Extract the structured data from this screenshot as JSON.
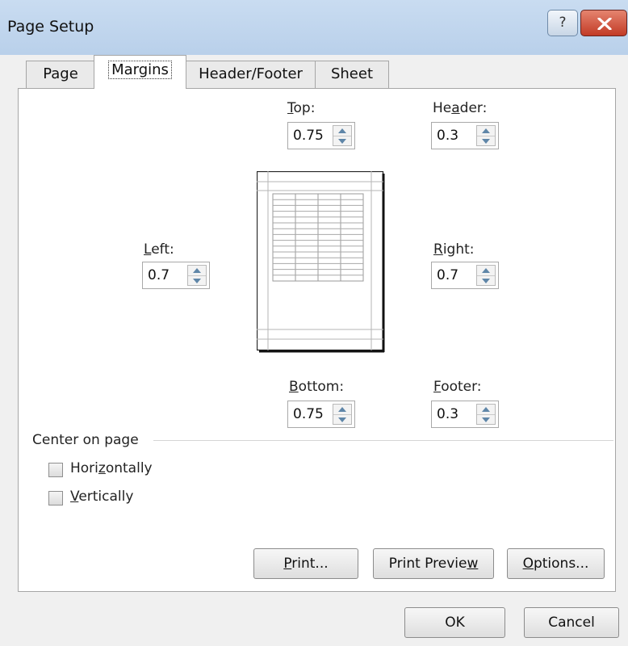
{
  "window": {
    "title": "Page Setup",
    "help_label": "?"
  },
  "tabs": [
    {
      "label": "Page",
      "active": false
    },
    {
      "label": "Margins",
      "active": true
    },
    {
      "label": "Header/Footer",
      "active": false
    },
    {
      "label": "Sheet",
      "active": false
    }
  ],
  "margins": {
    "top": {
      "label_key": "T",
      "label_rest": "op:",
      "value": "0.75"
    },
    "header": {
      "label_pre": "He",
      "label_key": "a",
      "label_post": "der:",
      "value": "0.3"
    },
    "left": {
      "label_key": "L",
      "label_rest": "eft:",
      "value": "0.7"
    },
    "right": {
      "label_key": "R",
      "label_rest": "ight:",
      "value": "0.7"
    },
    "bottom": {
      "label_key": "B",
      "label_rest": "ottom:",
      "value": "0.75"
    },
    "footer": {
      "label_key": "F",
      "label_rest": "ooter:",
      "value": "0.3"
    }
  },
  "center_on_page": {
    "heading": "Center on page",
    "horizontally": {
      "pre": "Hori",
      "key": "z",
      "post": "ontally",
      "checked": false
    },
    "vertically": {
      "key": "V",
      "post": "ertically",
      "checked": false
    }
  },
  "buttons": {
    "print": {
      "key": "P",
      "post": "rint..."
    },
    "print_preview": {
      "pre": "Print Previe",
      "key": "w"
    },
    "options": {
      "key": "O",
      "post": "ptions..."
    },
    "ok": "OK",
    "cancel": "Cancel"
  },
  "colors": {
    "titlebar": "#c3d7ee",
    "close_button": "#c94a36",
    "spinner_arrow": "#5f86a8"
  }
}
